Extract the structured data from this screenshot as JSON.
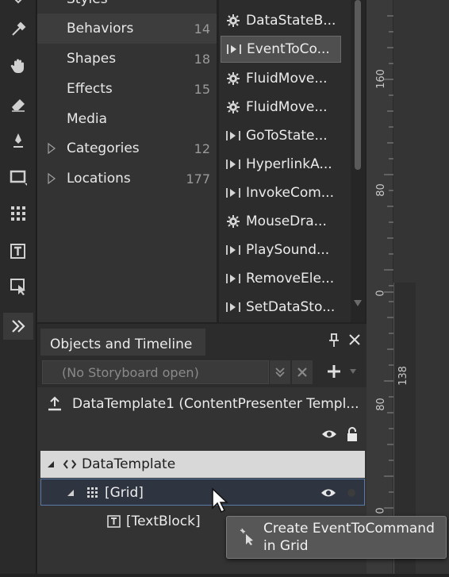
{
  "categories": {
    "items": [
      {
        "label": "Styles",
        "count": ""
      },
      {
        "label": "Behaviors",
        "count": "14"
      },
      {
        "label": "Shapes",
        "count": "18"
      },
      {
        "label": "Effects",
        "count": "15"
      },
      {
        "label": "Media",
        "count": ""
      },
      {
        "label": "Categories",
        "count": "12"
      },
      {
        "label": "Locations",
        "count": "177"
      }
    ]
  },
  "assets": {
    "items": [
      {
        "label": "DataStateB...",
        "icon": "gear-icon"
      },
      {
        "label": "EventToCo...",
        "icon": "trigger-action-icon"
      },
      {
        "label": "FluidMove...",
        "icon": "gear-icon"
      },
      {
        "label": "FluidMove...",
        "icon": "gear-icon"
      },
      {
        "label": "GoToState...",
        "icon": "trigger-action-icon"
      },
      {
        "label": "HyperlinkA...",
        "icon": "trigger-action-icon"
      },
      {
        "label": "InvokeCom...",
        "icon": "trigger-action-icon"
      },
      {
        "label": "MouseDra...",
        "icon": "gear-icon"
      },
      {
        "label": "PlaySound...",
        "icon": "trigger-action-icon"
      },
      {
        "label": "RemoveEle...",
        "icon": "trigger-action-icon"
      },
      {
        "label": "SetDataSto...",
        "icon": "trigger-action-icon"
      }
    ]
  },
  "ruler": {
    "labels": [
      "160",
      "80",
      "0",
      "80",
      "0"
    ],
    "dimension": "138"
  },
  "objects_panel": {
    "title": "Objects and Timeline",
    "storyboard_placeholder": "(No Storyboard open)",
    "scope_label": "DataTemplate1 (ContentPresenter Templ...",
    "tree": {
      "data_template": "DataTemplate",
      "grid": "[Grid]",
      "textblock": "[TextBlock]"
    }
  },
  "tooltip": {
    "line1": "Create EventToCommand",
    "line2": "in Grid"
  },
  "colors": {
    "selected_row_bg": "#d8d8d8",
    "hover_row_border": "#5a7aa8",
    "panel_bg": "#333333"
  }
}
